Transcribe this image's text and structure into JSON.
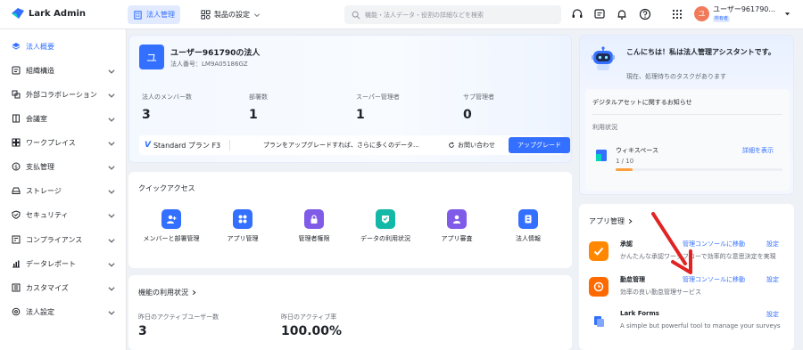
{
  "app": {
    "logo_text": "Lark Admin"
  },
  "topnav": {
    "tabs": [
      {
        "label": "法人管理",
        "icon": "building-icon",
        "active": true
      },
      {
        "label": "製品の設定",
        "icon": "grid-gear-icon",
        "active": false
      }
    ],
    "search_placeholder": "機能・法人データ・役割の詳細などを検索"
  },
  "user": {
    "name": "ユーザー961790...",
    "badge": "所有者",
    "avatar_initial": "ユ"
  },
  "sidebar": {
    "items": [
      {
        "label": "法人概要",
        "icon": "layers-icon",
        "active": true,
        "expandable": false
      },
      {
        "label": "組織構造",
        "icon": "org-icon",
        "expandable": true
      },
      {
        "label": "外部コラボレーション",
        "icon": "collab-icon",
        "expandable": true
      },
      {
        "label": "会議室",
        "icon": "meeting-room-icon",
        "expandable": true
      },
      {
        "label": "ワークプレイス",
        "icon": "workplace-icon",
        "expandable": true
      },
      {
        "label": "支払管理",
        "icon": "payment-icon",
        "expandable": true
      },
      {
        "label": "ストレージ",
        "icon": "storage-icon",
        "expandable": true
      },
      {
        "label": "セキュリティ",
        "icon": "shield-icon",
        "expandable": true
      },
      {
        "label": "コンプライアンス",
        "icon": "compliance-icon",
        "expandable": true
      },
      {
        "label": "データレポート",
        "icon": "report-icon",
        "expandable": true
      },
      {
        "label": "カスタマイズ",
        "icon": "customize-icon",
        "expandable": true
      },
      {
        "label": "法人設定",
        "icon": "settings-icon",
        "expandable": true
      }
    ]
  },
  "corp": {
    "avatar": "ユ",
    "name": "ユーザー961790の法人",
    "id_text": "法人番号：LM9A05186GZ",
    "stats": [
      {
        "label": "法人のメンバー数",
        "value": "3"
      },
      {
        "label": "部署数",
        "value": "1"
      },
      {
        "label": "スーパー管理者",
        "value": "1"
      },
      {
        "label": "サブ管理者",
        "value": "0"
      }
    ],
    "plan": {
      "name": "Standard プラン F3",
      "message": "プランをアップグレードすれば、さらに多くのデータ...",
      "contact_label": "お問い合わせ",
      "upgrade_label": "アップグレード"
    }
  },
  "quick_access": {
    "title": "クイックアクセス",
    "items": [
      {
        "label": "メンバーと部署管理",
        "icon": "member-icon",
        "color": "#3370ff"
      },
      {
        "label": "アプリ管理",
        "icon": "apps-icon",
        "color": "#3370ff"
      },
      {
        "label": "管理者権限",
        "icon": "lock-icon",
        "color": "#7f5be8"
      },
      {
        "label": "データの利用状況",
        "icon": "data-icon",
        "color": "#14b8a6"
      },
      {
        "label": "アプリ審査",
        "icon": "review-icon",
        "color": "#7f5be8"
      },
      {
        "label": "法人情報",
        "icon": "info-icon",
        "color": "#3370ff"
      }
    ]
  },
  "usage": {
    "title": "機能の利用状況",
    "items": [
      {
        "label": "昨日のアクティブユーザー数",
        "value": "3"
      },
      {
        "label": "昨日のアクティブ率",
        "value": "100.00%"
      }
    ]
  },
  "assistant": {
    "title": "こんにちは！私は法人管理アシスタントです。",
    "subtitle": "現在、処理待ちのタスクがあります",
    "notice_title": "デジタルアセットに関するお知らせ",
    "usage_status": "利用状況",
    "wiki": {
      "name": "ウィキスペース",
      "count": "1 / 10",
      "detail_label": "詳細を表示",
      "used": 1,
      "total": 10
    }
  },
  "apps": {
    "title": "アプリ管理",
    "items": [
      {
        "name": "承認",
        "desc": "かんたんな承認ワークフローで効率的な意思決定を実現",
        "console": "管理コンソールに移動",
        "settings": "設定",
        "color": "#ff8800",
        "icon": "approval-icon"
      },
      {
        "name": "勤怠管理",
        "desc": "効率の良い勤怠管理サービス",
        "console": "管理コンソールに移動",
        "settings": "設定",
        "color": "#ff6a00",
        "icon": "attendance-icon"
      },
      {
        "name": "Lark Forms",
        "desc": "A simple but powerful tool to manage your surveys",
        "console": "",
        "settings": "設定",
        "color": "#3370ff",
        "icon": "forms-icon"
      }
    ]
  },
  "colors": {
    "accent": "#3370ff",
    "annotation_arrow": "#e02424"
  }
}
